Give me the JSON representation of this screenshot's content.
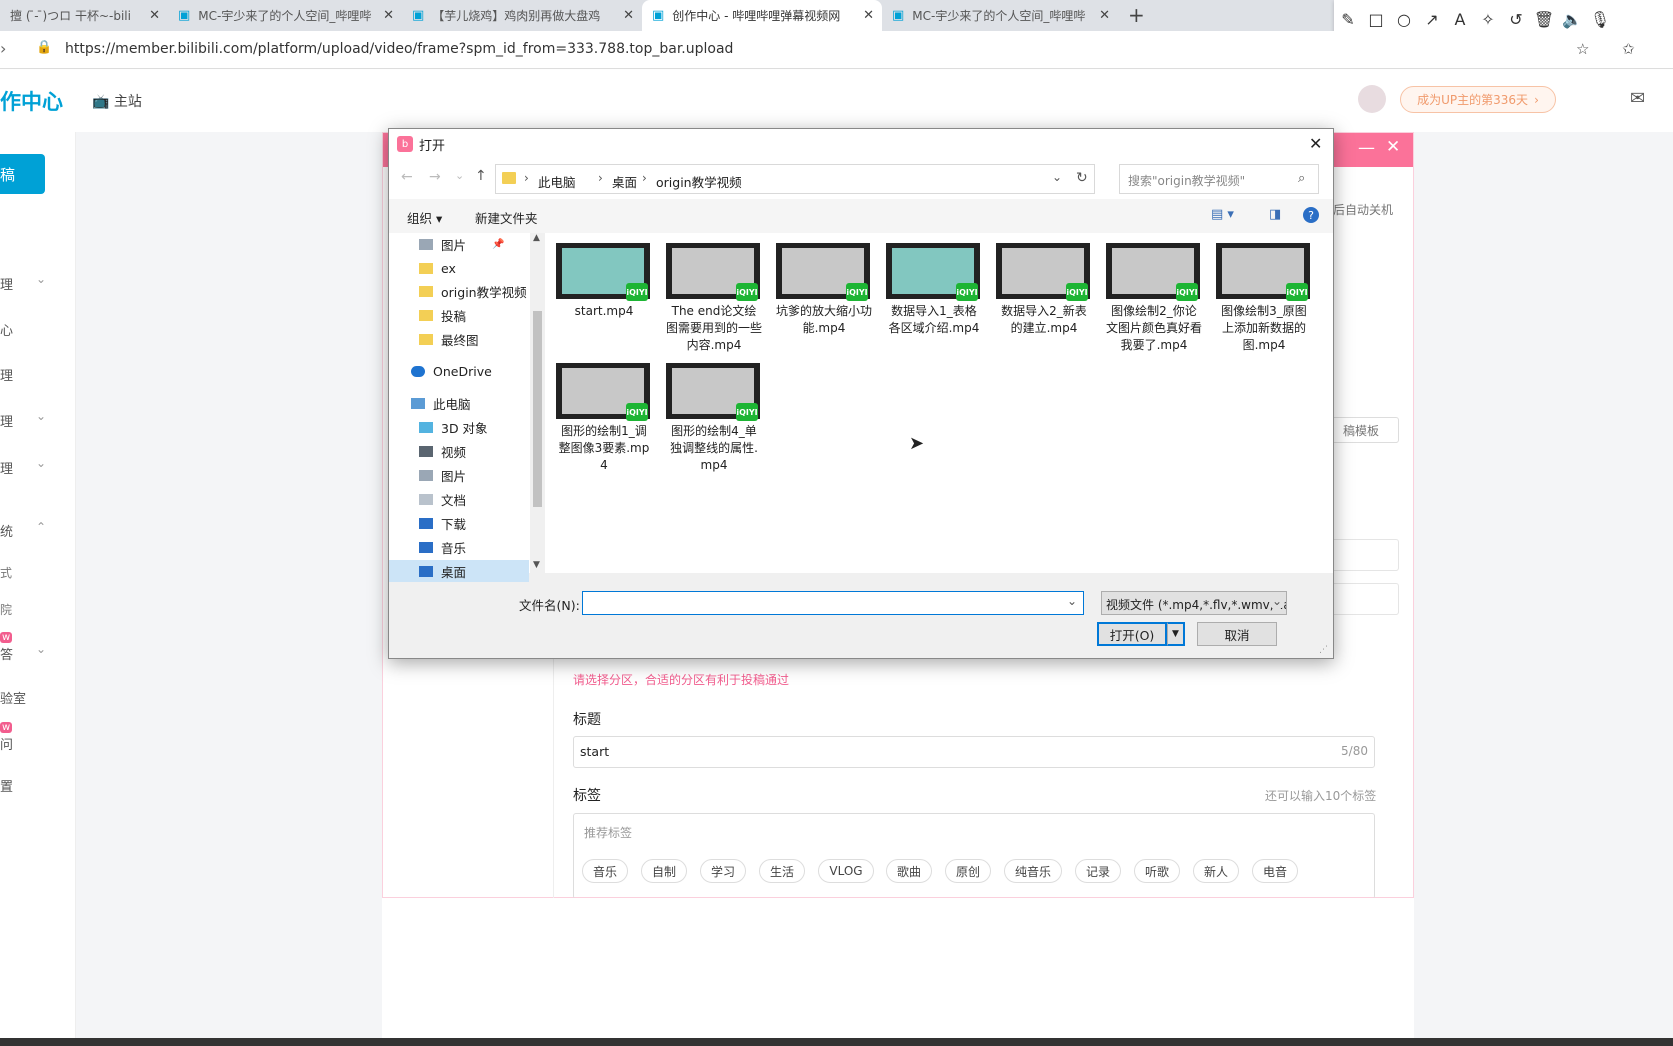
{
  "browser": {
    "tabs": [
      {
        "label": "擅 (  ̄- ̄)つロ 干杯~-bili"
      },
      {
        "label": "MC-宇少来了的个人空间_哔哩哔"
      },
      {
        "label": "【芋儿烧鸡】鸡肉别再做大盘鸡"
      },
      {
        "label": "创作中心 - 哔哩哔哩弹幕视频网"
      },
      {
        "label": "MC-宇少来了的个人空间_哔哩哔"
      }
    ],
    "url": "https://member.bilibili.com/platform/upload/video/frame?spm_id_from=333.788.top_bar.upload"
  },
  "site": {
    "logo_text": "作中心",
    "main_site": "主站",
    "up_days": "成为UP主的第336天",
    "upload_btn": "稿",
    "sidebar_chars": [
      "理",
      "心",
      "理",
      "理",
      "理",
      "统",
      "式",
      "院",
      "答",
      "验室",
      "问",
      "置"
    ],
    "new_badge": "w",
    "auto_shutdown": "后自动关机",
    "template_btn": "稿模板",
    "category_hint": "请选择分区，合适的分区有利于投稿通过",
    "title_label": "标题",
    "title_value": "start",
    "title_count": "5/80",
    "tags_label": "标签",
    "tags_remaining": "还可以输入10个标签",
    "recommended_label": "推荐标签",
    "tags": [
      "音乐",
      "自制",
      "学习",
      "生活",
      "VLOG",
      "歌曲",
      "原创",
      "纯音乐",
      "记录",
      "听歌",
      "新人",
      "电音"
    ]
  },
  "dialog": {
    "title": "打开",
    "breadcrumb": [
      "此电脑",
      "桌面",
      "origin教学视频"
    ],
    "search_placeholder": "搜索\"origin教学视频\"",
    "organize": "组织 ▾",
    "new_folder": "新建文件夹",
    "tree": [
      {
        "label": "图片"
      },
      {
        "label": "ex"
      },
      {
        "label": "origin教学视频"
      },
      {
        "label": "投稿"
      },
      {
        "label": "最终图"
      },
      {
        "label": "OneDrive"
      },
      {
        "label": "此电脑"
      },
      {
        "label": "3D 对象"
      },
      {
        "label": "视频"
      },
      {
        "label": "图片"
      },
      {
        "label": "文档"
      },
      {
        "label": "下载"
      },
      {
        "label": "音乐"
      },
      {
        "label": "桌面"
      }
    ],
    "files": [
      {
        "name": "start.mp4"
      },
      {
        "name": "The end论文绘图需要用到的一些内容.mp4"
      },
      {
        "name": "坑爹的放大缩小功能.mp4"
      },
      {
        "name": "数据导入1_表格各区域介绍.mp4"
      },
      {
        "name": "数据导入2_新表的建立.mp4"
      },
      {
        "name": "图像绘制2_你论文图片颜色真好看我要了.mp4"
      },
      {
        "name": "图像绘制3_原图上添加新数据的图.mp4"
      },
      {
        "name": "图形的绘制1_调整图像3要素.mp4"
      },
      {
        "name": "图形的绘制4_单独调整线的属性.mp4"
      }
    ],
    "badge_text": "iQIYI",
    "filename_label": "文件名(N):",
    "filename_value": "",
    "filetype": "视频文件 (*.mp4,*.flv,*.wmv,*.a",
    "open_btn": "打开(O)",
    "cancel_btn": "取消"
  }
}
